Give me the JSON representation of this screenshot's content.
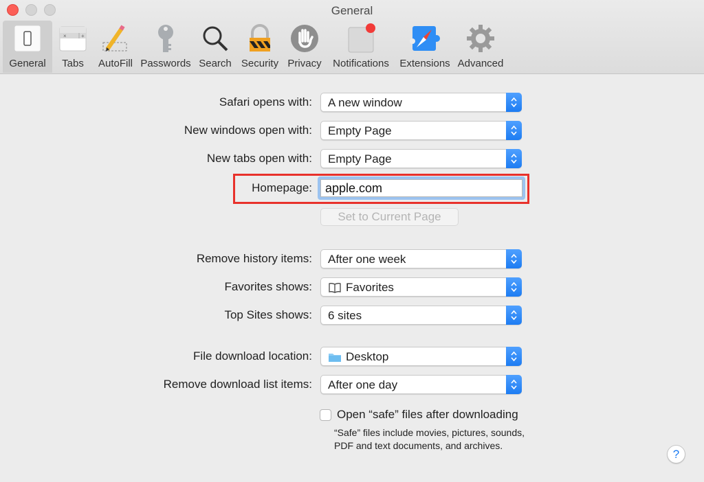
{
  "window": {
    "title": "General"
  },
  "toolbar": {
    "items": [
      {
        "label": "General",
        "icon": "general-switch-icon",
        "active": true
      },
      {
        "label": "Tabs",
        "icon": "tabs-icon"
      },
      {
        "label": "AutoFill",
        "icon": "pencil-icon"
      },
      {
        "label": "Passwords",
        "icon": "key-icon"
      },
      {
        "label": "Search",
        "icon": "magnifier-icon"
      },
      {
        "label": "Security",
        "icon": "padlock-icon"
      },
      {
        "label": "Privacy",
        "icon": "hand-icon"
      },
      {
        "label": "Notifications",
        "icon": "notification-badge-icon"
      },
      {
        "label": "Extensions",
        "icon": "puzzle-compass-icon"
      },
      {
        "label": "Advanced",
        "icon": "gear-icon"
      }
    ]
  },
  "settings": {
    "safari_opens_with": {
      "label": "Safari opens with:",
      "value": "A new window"
    },
    "new_windows_open_with": {
      "label": "New windows open with:",
      "value": "Empty Page"
    },
    "new_tabs_open_with": {
      "label": "New tabs open with:",
      "value": "Empty Page"
    },
    "homepage": {
      "label": "Homepage:",
      "value": "apple.com"
    },
    "set_current_page": {
      "label": "Set to Current Page"
    },
    "remove_history": {
      "label": "Remove history items:",
      "value": "After one week"
    },
    "favorites_shows": {
      "label": "Favorites shows:",
      "value": "Favorites",
      "icon": "book-icon"
    },
    "top_sites_shows": {
      "label": "Top Sites shows:",
      "value": "6 sites"
    },
    "download_location": {
      "label": "File download location:",
      "value": "Desktop",
      "icon": "folder-icon"
    },
    "remove_download_items": {
      "label": "Remove download list items:",
      "value": "After one day"
    },
    "open_safe_files": {
      "label": "Open “safe” files after downloading",
      "checked": false,
      "description": "“Safe” files include movies, pictures, sounds, PDF and text documents, and archives."
    }
  },
  "help": {
    "label": "?"
  },
  "colors": {
    "accent": "#1d7cf2",
    "highlight": "#e8312b",
    "close": "#fc5f57"
  }
}
